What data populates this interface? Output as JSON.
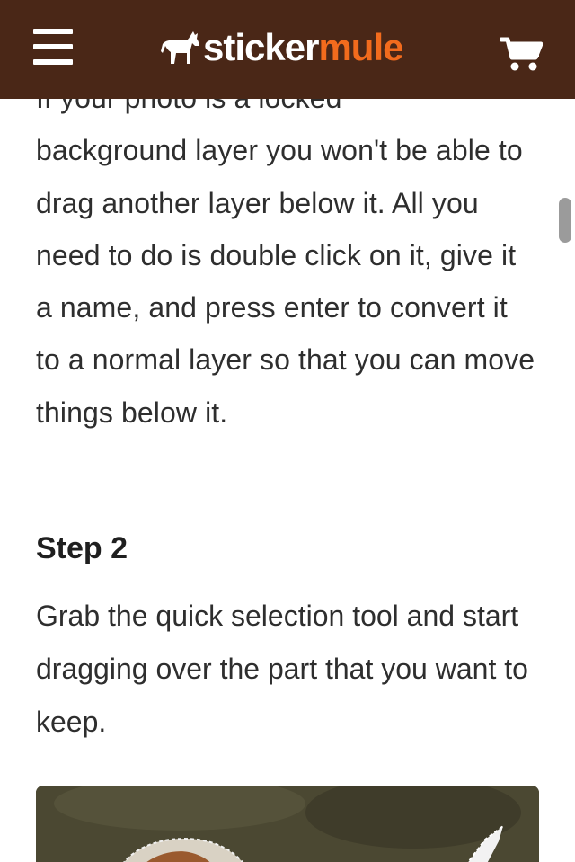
{
  "header": {
    "brand_part1": "sticker",
    "brand_part2": "mule",
    "menu_icon": "hamburger-menu-icon",
    "cart_icon": "shopping-cart-icon",
    "logo_icon": "mule-logo-icon"
  },
  "colors": {
    "header_bg": "#4a2717",
    "brand_orange": "#f26b1d",
    "text": "#2e2e2e"
  },
  "article": {
    "cut_off_line": "If your photo is a locked",
    "paragraph1": "background layer you won't be able to drag another layer below it. All you need to do is double click on it, give it a name, and press enter to convert it to a normal layer so that you can move things below it.",
    "step_heading": "Step 2",
    "paragraph2": "Grab the quick selection tool and start dragging over the part that you want to keep."
  },
  "image": {
    "description_icon": "photo-of-dog-with-selection"
  }
}
